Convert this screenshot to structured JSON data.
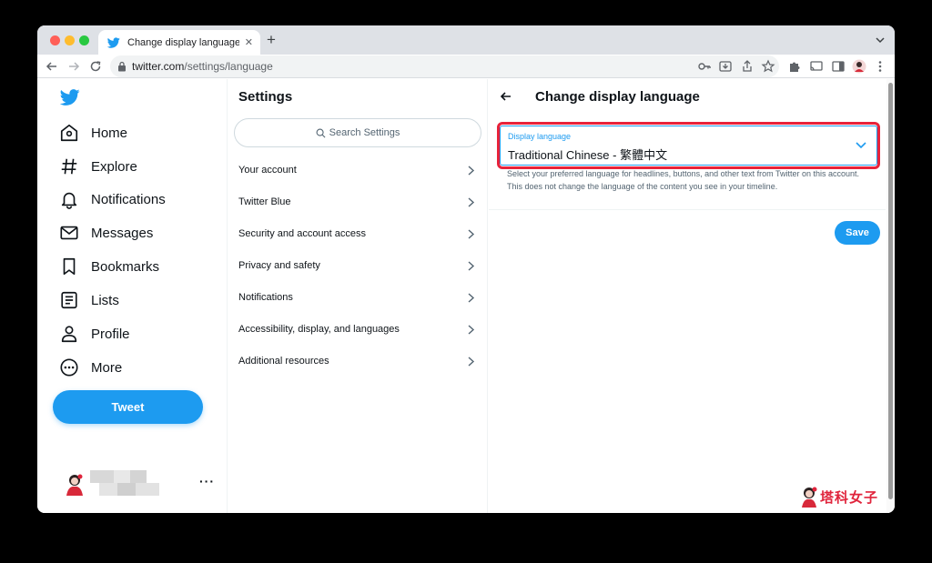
{
  "browser": {
    "tab_title": "Change display language / Twitter",
    "url_host": "twitter.com",
    "url_path": "/settings/language"
  },
  "nav": {
    "items": [
      {
        "label": "Home",
        "icon": "home-icon"
      },
      {
        "label": "Explore",
        "icon": "hashtag-icon"
      },
      {
        "label": "Notifications",
        "icon": "bell-icon"
      },
      {
        "label": "Messages",
        "icon": "envelope-icon"
      },
      {
        "label": "Bookmarks",
        "icon": "bookmark-icon"
      },
      {
        "label": "Lists",
        "icon": "list-icon"
      },
      {
        "label": "Profile",
        "icon": "person-icon"
      },
      {
        "label": "More",
        "icon": "more-circle-icon"
      }
    ],
    "tweet_label": "Tweet",
    "more_label": "···"
  },
  "settings": {
    "title": "Settings",
    "search_placeholder": "Search Settings",
    "items": [
      "Your account",
      "Twitter Blue",
      "Security and account access",
      "Privacy and safety",
      "Notifications",
      "Accessibility, display, and languages",
      "Additional resources"
    ]
  },
  "detail": {
    "title": "Change display language",
    "field_label": "Display language",
    "field_value": "Traditional Chinese - 繁體中文",
    "helper": "Select your preferred language for headlines, buttons, and other text from Twitter on this account. This does not change the language of the content you see in your timeline.",
    "save_label": "Save",
    "watermark": "塔科女子"
  },
  "colors": {
    "accent": "#1d9bf0",
    "highlight": "#e8223a",
    "watermark": "#e0243c"
  }
}
